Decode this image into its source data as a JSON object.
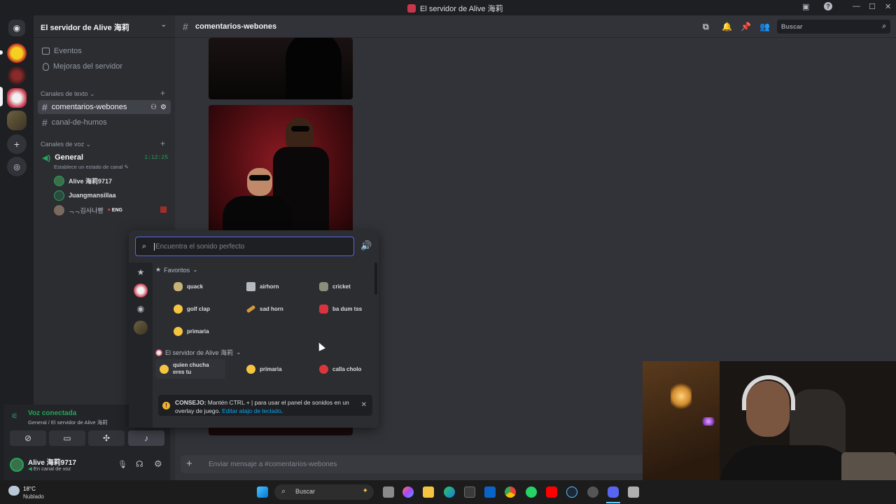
{
  "window": {
    "title": "El servidor de Alive 海莉"
  },
  "sidebar": {
    "server_name": "El servidor de Alive 海莉",
    "top_items": [
      {
        "label": "Eventos",
        "icon": "calendar-icon"
      },
      {
        "label": "Mejoras del servidor",
        "icon": "boost-icon"
      }
    ],
    "text_category": "Canales de texto",
    "text_channels": [
      {
        "label": "comentarios-webones",
        "selected": true
      },
      {
        "label": "canal-de-humos",
        "selected": false
      }
    ],
    "voice_category": "Canales de voz",
    "voice_channel": {
      "label": "General",
      "timer": "1:12:25",
      "status": "Establece un estado de canal"
    },
    "voice_users": [
      {
        "name": "Alive 海莉9717"
      },
      {
        "name": "Juangmansillaa"
      },
      {
        "name": "ᆨᆨ김사나뺨",
        "badge": "ENG"
      }
    ]
  },
  "voice_panel": {
    "status": "Voz conectada",
    "location": "General / El servidor de Alive 海莉"
  },
  "user_panel": {
    "name": "Alive 海莉9717",
    "status": "En canal de voz"
  },
  "channel": {
    "name": "comentarios-webones",
    "search_placeholder": "Buscar",
    "composer_placeholder": "Enviar mensaje a #comentarios-webones"
  },
  "soundboard": {
    "search_placeholder": "Encuentra el sonido perfecto",
    "favorites_label": "Favoritos",
    "favorites": [
      {
        "label": "quack",
        "icon": "duck-icon"
      },
      {
        "label": "airhorn",
        "icon": "speaker-icon"
      },
      {
        "label": "cricket",
        "icon": "cricket-icon"
      },
      {
        "label": "golf clap",
        "icon": "clap-icon"
      },
      {
        "label": "sad horn",
        "icon": "horn-icon"
      },
      {
        "label": "ba dum tss",
        "icon": "drum-icon"
      },
      {
        "label": "primaria",
        "icon": "disappointed-face-icon"
      }
    ],
    "server_section_label": "El servidor de Alive 海莉",
    "server_sounds": [
      {
        "label": "quien chucha eres tu",
        "icon": "smile-face-icon"
      },
      {
        "label": "primaria",
        "icon": "disappointed-face-icon"
      },
      {
        "label": "calla cholo",
        "icon": "angry-face-icon"
      }
    ],
    "tip_bold": "CONSEJO:",
    "tip_text": " Mantén CTRL + | para usar el panel de sonidos en un overlay de juego. ",
    "tip_link": "Editar atajo de teclado",
    "tip_end": "."
  },
  "taskbar": {
    "weather_temp": "18°C",
    "weather_desc": "Nublado",
    "search_label": "Buscar"
  },
  "colors": {
    "accent": "#5865f2",
    "voice_green": "#23a55a",
    "link": "#00a8fc"
  }
}
